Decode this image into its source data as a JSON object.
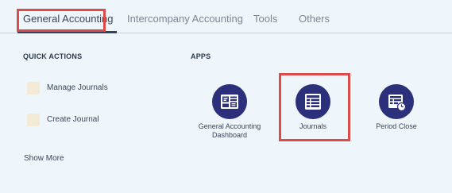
{
  "tabs": [
    {
      "label": "General Accounting",
      "active": true
    },
    {
      "label": "Intercompany Accounting",
      "active": false
    },
    {
      "label": "Tools",
      "active": false
    },
    {
      "label": "Others",
      "active": false
    }
  ],
  "quick_actions": {
    "title": "QUICK ACTIONS",
    "items": [
      {
        "label": "Manage Journals"
      },
      {
        "label": "Create Journal"
      }
    ],
    "show_more": "Show More"
  },
  "apps": {
    "title": "APPS",
    "items": [
      {
        "label": "General Accounting Dashboard",
        "icon": "dashboard-icon"
      },
      {
        "label": "Journals",
        "icon": "journal-icon"
      },
      {
        "label": "Period Close",
        "icon": "period-close-icon"
      }
    ]
  },
  "colors": {
    "background": "#eef5fb",
    "app_circle": "#2c2f7a",
    "highlight": "#dd4b4b",
    "active_tab": "#33425a"
  }
}
